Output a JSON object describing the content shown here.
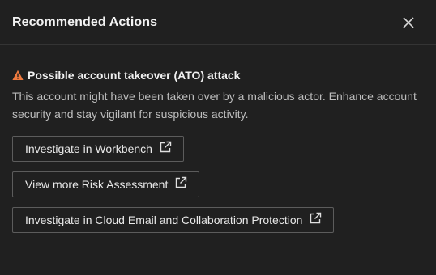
{
  "panel": {
    "title": "Recommended Actions",
    "close_icon": "close-icon"
  },
  "alert": {
    "icon": "warning-triangle-icon",
    "icon_color": "#f07b3f",
    "title": "Possible account takeover (ATO) attack",
    "description": "This account might have been taken over by a malicious actor. Enhance account security and stay vigilant for suspicious activity."
  },
  "actions": [
    {
      "label": "Investigate in Workbench",
      "icon": "external-link-icon"
    },
    {
      "label": "View more Risk Assessment",
      "icon": "external-link-icon"
    },
    {
      "label": "Investigate in Cloud Email and Collaboration Protection",
      "icon": "external-link-icon"
    }
  ]
}
